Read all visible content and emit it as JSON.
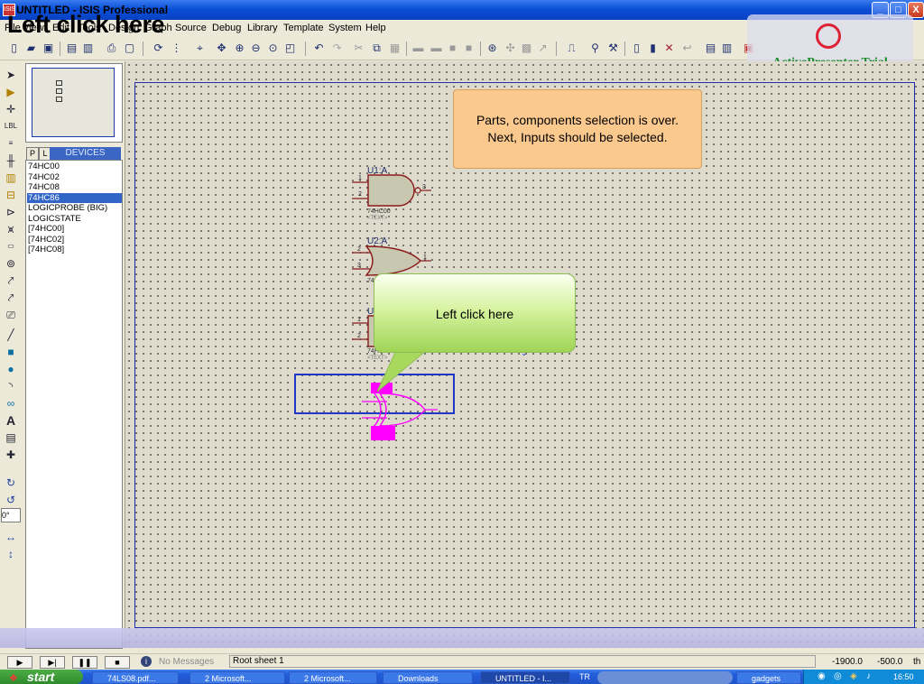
{
  "window": {
    "title": "UNTITLED - ISIS Professional",
    "icon_label": "ISIS",
    "minimize": "_",
    "maximize": "□",
    "close": "X"
  },
  "caption": "Left click here",
  "menu": [
    "File",
    "View",
    "Edit",
    "Tools",
    "Design",
    "Graph",
    "Source",
    "Debug",
    "Library",
    "Template",
    "System",
    "Help"
  ],
  "watermark": {
    "text": "ActivePresenter Trial"
  },
  "device_panel": {
    "tab_p": "P",
    "tab_l": "L",
    "title": "DEVICES",
    "items": [
      "74HC00",
      "74HC02",
      "74HC08",
      "74HC86",
      "LOGICPROBE (BIG)",
      "LOGICSTATE",
      "[74HC00]",
      "[74HC02]",
      "[74HC08]"
    ],
    "selected_index": 3
  },
  "rotation": {
    "angle": "0°"
  },
  "note": {
    "line1": "Parts, components selection is over.",
    "line2": "Next, Inputs should be selected."
  },
  "callout": {
    "text": "Left click here"
  },
  "gates": [
    {
      "ref": "U1:A",
      "part": "74HC00",
      "text": "<TEXT>",
      "pins": [
        "1",
        "2",
        "3"
      ]
    },
    {
      "ref": "U2:A",
      "part": "74HC02",
      "pins": [
        "2",
        "3",
        "1"
      ]
    },
    {
      "ref": "U",
      "part": "74HC",
      "text": "<TEXT>",
      "pins": [
        "1",
        "2"
      ]
    }
  ],
  "status": {
    "messages": "No Messages",
    "sheet": "Root sheet 1",
    "x": "-1900.0",
    "y": "-500.0",
    "unit": "th"
  },
  "taskbar": {
    "start": "start",
    "tasks": [
      "74LS08.pdf...",
      "2 Microsoft...",
      "2 Microsoft...",
      "Downloads",
      "UNTITLED - I...",
      "gadgets"
    ],
    "tray_lang": "TR",
    "clock": "16:50"
  }
}
